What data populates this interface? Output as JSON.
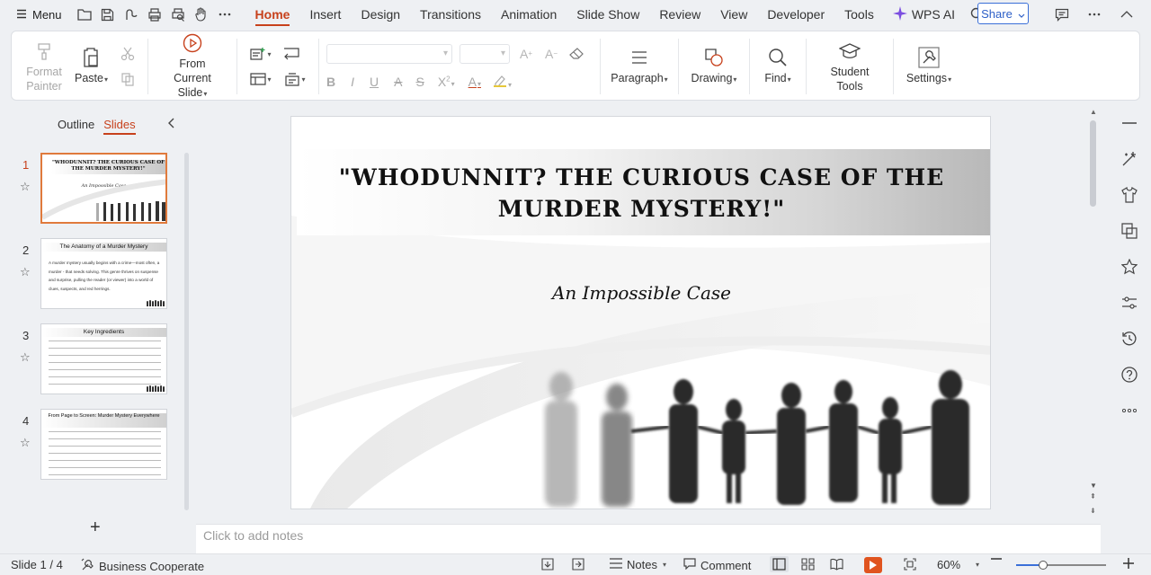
{
  "menubar": {
    "menu_label": "Menu",
    "tabs": [
      {
        "label": "Home",
        "active": true
      },
      {
        "label": "Insert"
      },
      {
        "label": "Design"
      },
      {
        "label": "Transitions"
      },
      {
        "label": "Animation"
      },
      {
        "label": "Slide Show"
      },
      {
        "label": "Review"
      },
      {
        "label": "View"
      },
      {
        "label": "Developer"
      },
      {
        "label": "Tools"
      }
    ],
    "wps_ai_label": "WPS AI",
    "share_label": "Share"
  },
  "ribbon": {
    "format_painter_line1": "Format",
    "format_painter_line2": "Painter",
    "paste_label": "Paste",
    "from_current_line1": "From Current",
    "from_current_line2": "Slide",
    "paragraph_label": "Paragraph",
    "drawing_label": "Drawing",
    "find_label": "Find",
    "student_tools_label": "Student Tools",
    "settings_label": "Settings"
  },
  "left_panel": {
    "outline_tab": "Outline",
    "slides_tab": "Slides",
    "thumbnails": [
      {
        "number": "1",
        "title": "\"WHODUNNIT? THE CURIOUS CASE OF THE MURDER MYSTERY!\"",
        "subtitle": "An Impossible Case"
      },
      {
        "number": "2",
        "title": "The Anatomy of a Murder Mystery",
        "body": "A murder mystery usually begins with a crime—most often, a murder - that needs solving. This genre thrives on suspense and surprise, pulling the reader (or viewer) into a world of clues, suspects, and red herrings."
      },
      {
        "number": "3",
        "title": "Key Ingredients"
      },
      {
        "number": "4",
        "title": "From Page to Screen: Murder Mystery Everywhere"
      }
    ]
  },
  "slide": {
    "title": "\"WHODUNNIT? THE CURIOUS CASE OF THE MURDER MYSTERY!\"",
    "title_line1": "\"WHODUNNIT? THE CURIOUS CASE OF THE",
    "title_line2": "MURDER MYSTERY!\"",
    "subtitle": "An Impossible Case"
  },
  "notes": {
    "placeholder": "Click to add notes"
  },
  "statusbar": {
    "slide_counter": "Slide 1 / 4",
    "business_label": "Business Cooperate",
    "notes_label": "Notes",
    "comment_label": "Comment",
    "zoom_label": "60%",
    "zoom_fraction": 0.3
  },
  "colors": {
    "accent": "#c7411c",
    "share_blue": "#2d5fc7",
    "slideshow_orange": "#e0541f"
  }
}
